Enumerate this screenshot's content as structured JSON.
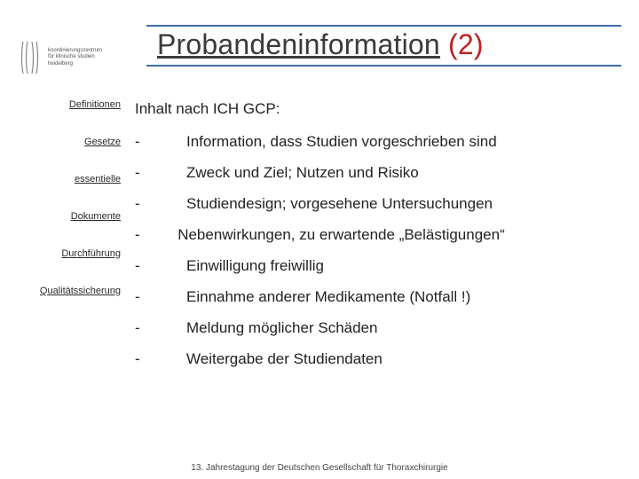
{
  "logo": {
    "lines": "koordinierungszentrum\nfür klinische studien\nheidelberg"
  },
  "title": {
    "main": "Probandeninformation",
    "suffix": " (2)"
  },
  "sidebar": {
    "items": [
      {
        "label": "Definitionen"
      },
      {
        "label": "Gesetze"
      },
      {
        "label": "essentielle"
      },
      {
        "label": "Dokumente"
      },
      {
        "label": "Durchführung"
      },
      {
        "label": "Qualitätssicherung"
      }
    ]
  },
  "content": {
    "heading": "Inhalt nach ICH GCP:",
    "items": [
      {
        "text": "Information, dass Studien vorgeschrieben sind"
      },
      {
        "text": "Zweck und Ziel; Nutzen und Risiko"
      },
      {
        "text": "Studiendesign; vorgesehene Untersuchungen"
      },
      {
        "text": "Nebenwirkungen, zu erwartende „Belästigungen“",
        "wrap": true
      },
      {
        "text": "Einwilligung freiwillig"
      },
      {
        "text": "Einnahme anderer Medikamente (Notfall !)"
      },
      {
        "text": "Meldung möglicher Schäden"
      },
      {
        "text": "Weitergabe der Studiendaten"
      }
    ]
  },
  "footer": "13. Jahrestagung der Deutschen Gesellschaft für Thoraxchirurgie"
}
